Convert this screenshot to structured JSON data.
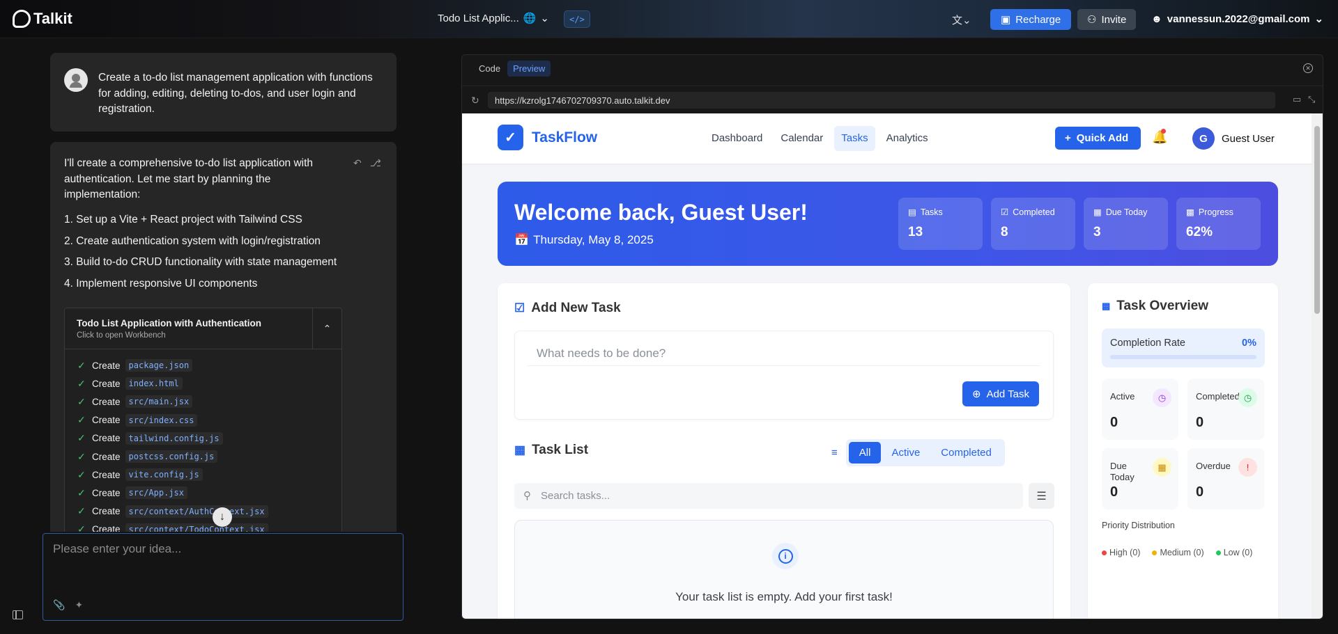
{
  "app": {
    "name": "Talkit",
    "project_title": "Todo List Applic..."
  },
  "topbar": {
    "recharge_label": "Recharge",
    "invite_label": "Invite",
    "user_email": "vannessun.2022@gmail.com"
  },
  "chat": {
    "user_message": "Create a to-do list management application with functions for adding, editing, deleting to-dos, and user login and registration.",
    "ai_intro": "I'll create a comprehensive to-do list application with authentication. Let me start by planning the implementation:",
    "steps": [
      "1. Set up a Vite + React project with Tailwind CSS",
      "2. Create authentication system with login/registration",
      "3. Build to-do CRUD functionality with state management",
      "4. Implement responsive UI components"
    ],
    "workbench": {
      "title": "Todo List Application with Authentication",
      "subtitle": "Click to open Workbench",
      "action_label": "Create",
      "files": [
        "package.json",
        "index.html",
        "src/main.jsx",
        "src/index.css",
        "tailwind.config.js",
        "postcss.config.js",
        "vite.config.js",
        "src/App.jsx",
        "src/context/AuthContext.jsx",
        "src/context/TodoContext.jsx"
      ]
    },
    "input_placeholder": "Please enter your idea..."
  },
  "preview": {
    "tabs": [
      "Code",
      "Preview"
    ],
    "active_tab": "Preview",
    "url": "https://kzrolg1746702709370.auto.talkit.dev"
  },
  "site": {
    "brand": "TaskFlow",
    "nav": [
      "Dashboard",
      "Calendar",
      "Tasks",
      "Analytics"
    ],
    "active_nav": "Tasks",
    "quick_add_label": "Quick Add",
    "user_initial": "G",
    "user_name": "Guest User",
    "hero": {
      "greeting": "Welcome back, Guest User!",
      "date": "Thursday, May 8, 2025",
      "stats": [
        {
          "label": "Tasks",
          "value": "13"
        },
        {
          "label": "Completed",
          "value": "8"
        },
        {
          "label": "Due Today",
          "value": "3"
        },
        {
          "label": "Progress",
          "value": "62%"
        }
      ]
    },
    "add_task": {
      "title": "Add New Task",
      "placeholder": "What needs to be done?",
      "button": "Add Task"
    },
    "task_list": {
      "title": "Task List",
      "filters": [
        "All",
        "Active",
        "Completed"
      ],
      "active_filter": "All",
      "search_placeholder": "Search tasks...",
      "empty_message": "Your task list is empty. Add your first task!"
    },
    "overview": {
      "title": "Task Overview",
      "completion_label": "Completion Rate",
      "completion_value": "0%",
      "completion_fraction": 0,
      "cards": [
        {
          "label": "Active",
          "value": "0",
          "icon": "clock-icon",
          "color": "#9333ea",
          "bg": "#f3e8ff"
        },
        {
          "label": "Completed",
          "value": "0",
          "icon": "check-circle-icon",
          "color": "#16a34a",
          "bg": "#dcfce7"
        },
        {
          "label": "Due Today",
          "value": "0",
          "icon": "calendar-icon",
          "color": "#ca8a04",
          "bg": "#fef9c3"
        },
        {
          "label": "Overdue",
          "value": "0",
          "icon": "alert-icon",
          "color": "#dc2626",
          "bg": "#fee2e2"
        }
      ],
      "priority_title": "Priority Distribution",
      "priorities": [
        {
          "label": "High (0)",
          "color": "#ef4444"
        },
        {
          "label": "Medium (0)",
          "color": "#eab308"
        },
        {
          "label": "Low (0)",
          "color": "#22c55e"
        }
      ]
    }
  },
  "colors": {
    "accent": "#2563eb",
    "recharge": "#2f6fe8"
  }
}
